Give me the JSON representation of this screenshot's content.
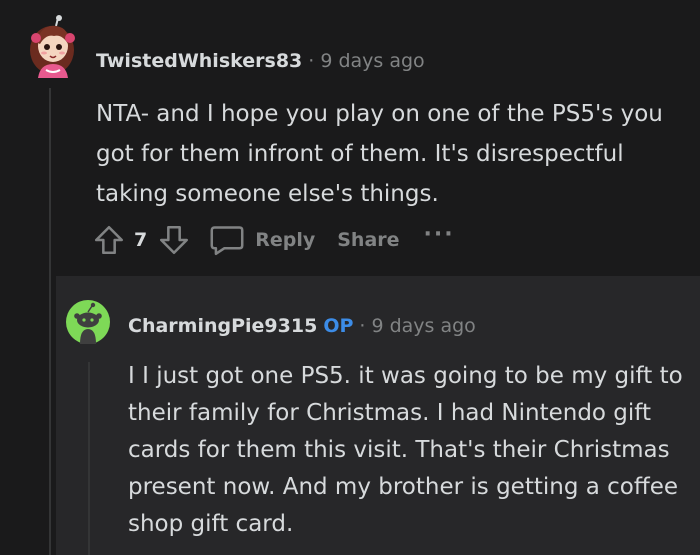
{
  "comments": [
    {
      "username": "TwistedWhiskers83",
      "separator": "·",
      "time": "9 days ago",
      "body": "NTA- and I hope you play on one of the PS5's you got for them infront of them. It's disrespectful taking someone else's things.",
      "votes": "7",
      "reply_label": "Reply",
      "share_label": "Share",
      "more_label": "···"
    },
    {
      "username": "CharmingPie9315",
      "badge": "OP",
      "separator": "·",
      "time": "9 days ago",
      "body": "I I just got one PS5. it was going to be my gift to their family for Christmas. I had Nintendo gift cards for them this visit. That's their Christmas present now. And my brother is getting a coffee shop gift card."
    }
  ],
  "colors": {
    "background": "#1a1a1b",
    "reply_background": "#272729",
    "text": "#d7dadc",
    "muted": "#818384",
    "op_badge": "#3c8ce7",
    "snoo_green": "#7ed957"
  },
  "icons": {
    "avatar1": "anime-girl-avatar",
    "avatar2": "green-snoo-avatar",
    "upvote": "upvote-arrow-icon",
    "downvote": "downvote-arrow-icon",
    "reply": "speech-bubble-icon",
    "more": "ellipsis-icon"
  }
}
